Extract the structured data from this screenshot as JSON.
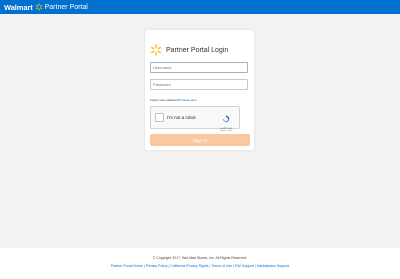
{
  "header": {
    "brand_name": "Walmart",
    "portal_name": "Partner Portal",
    "brand_color": "#0071ce",
    "spark_color": "#ffc220",
    "logo_icon": "walmart-spark-icon"
  },
  "login": {
    "title": "Partner Portal Login",
    "username_placeholder": "Username",
    "password_placeholder": "Password",
    "forgot_prefix": "Forgot your password?",
    "forgot_link": "Reset Here",
    "captcha_label": "I'm not a robot",
    "captcha_brand": "reCAPTCHA",
    "captcha_links": "Privacy - Terms",
    "signin_label": "Sign In",
    "signin_color": "#f8c9a0"
  },
  "footer": {
    "copyright": "© Copyright 2017, Wal-Mart Stores, Inc. All Rights Reserved.",
    "links": [
      "Partner Portal Home",
      "Privacy Policy",
      "California Privacy Rights",
      "Terms of Use",
      "EW Support",
      "Marketplace Support"
    ]
  }
}
